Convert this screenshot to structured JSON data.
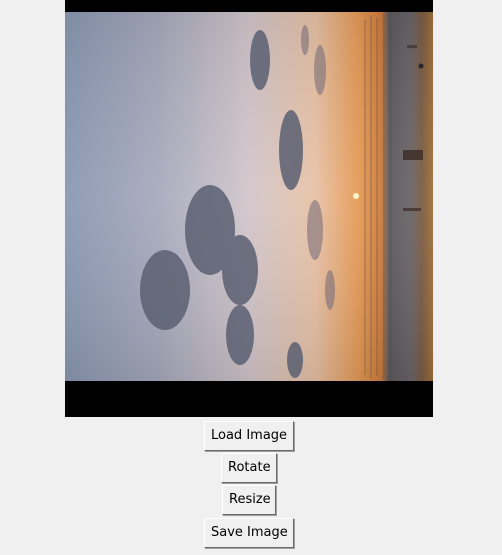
{
  "buttons": {
    "load": "Load Image",
    "rotate": "Rotate",
    "resize": "Resize",
    "save": "Save Image"
  },
  "image": {
    "subject": "sunset-over-sea-photo",
    "orientation": "rotated"
  },
  "colors": {
    "window_bg": "#f0f0f0",
    "canvas_bg": "#000000"
  }
}
